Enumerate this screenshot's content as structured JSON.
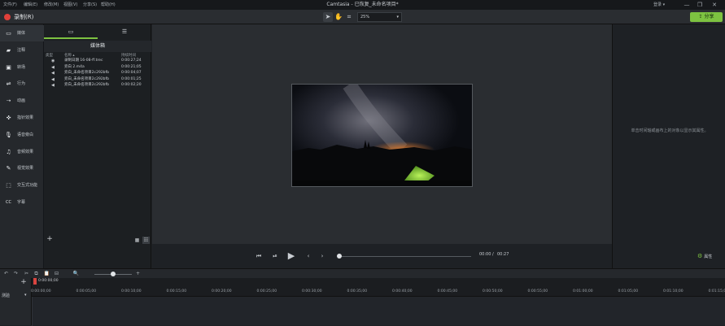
{
  "menu": [
    "文件(F)",
    "编辑(E)",
    "修改(M)",
    "视图(V)",
    "分享(S)",
    "帮助(H)"
  ],
  "app_title": "Camtasia - 已恢复_未命名项目*",
  "account": "登录 ▾",
  "window_controls": [
    "—",
    "❐",
    "✕"
  ],
  "toolbar": {
    "record_label": "录制(R)",
    "zoom_value": "25%",
    "share_label": "分享"
  },
  "sidebar": {
    "items": [
      {
        "label": "媒体",
        "icon": "media-icon",
        "glyph": "▭"
      },
      {
        "label": "注释",
        "icon": "annotation-icon",
        "glyph": "▰"
      },
      {
        "label": "转场",
        "icon": "transition-icon",
        "glyph": "▣"
      },
      {
        "label": "行为",
        "icon": "behavior-icon",
        "glyph": "⇌"
      },
      {
        "label": "动画",
        "icon": "animation-icon",
        "glyph": "➝"
      },
      {
        "label": "指针效果",
        "icon": "cursor-effect-icon",
        "glyph": "✜"
      },
      {
        "label": "语音旁白",
        "icon": "microphone-icon",
        "glyph": "🎙"
      },
      {
        "label": "音频效果",
        "icon": "audio-effect-icon",
        "glyph": "♫"
      },
      {
        "label": "视觉效果",
        "icon": "visual-effect-icon",
        "glyph": "✎"
      },
      {
        "label": "交互式功能",
        "icon": "interactive-icon",
        "glyph": "⬚"
      },
      {
        "label": "字幕",
        "icon": "cc-icon",
        "glyph": "CC"
      }
    ]
  },
  "bin": {
    "title": "媒体箱",
    "columns": {
      "type": "类型",
      "name": "名称 ▴",
      "duration": "持续时间"
    },
    "rows": [
      {
        "icon": "video-file-icon",
        "glyph": "◉",
        "name": "录制日期 16-08-ff.trec",
        "duration": "0:00:27;24"
      },
      {
        "icon": "audio-file-icon",
        "glyph": "◀",
        "name": "旁白 2.m4a",
        "duration": "0:00:21;05"
      },
      {
        "icon": "audio-file-icon",
        "glyph": "◀",
        "name": "旁白_未命名项目2c292bfb",
        "duration": "0:00:04;07"
      },
      {
        "icon": "audio-file-icon",
        "glyph": "◀",
        "name": "旁白_未命名项目2c292bfb",
        "duration": "0:00:01;25"
      },
      {
        "icon": "audio-file-icon",
        "glyph": "◀",
        "name": "旁白_未命名项目2c292bfb",
        "duration": "0:00:02;20"
      }
    ]
  },
  "playback": {
    "current": "00:00",
    "separator": "/",
    "total": "00:27",
    "progress": 0
  },
  "properties": {
    "message": "单击时间轴或画布上的对象以显示其属性。",
    "button": "属性"
  },
  "timeline": {
    "playhead": "0:00:00;00",
    "ticks": [
      "0:00:00;00",
      "0:00:05;00",
      "0:00:10;00",
      "0:00:15;00",
      "0:00:20;00",
      "0:00:25;00",
      "0:00:30;00",
      "0:00:35;00",
      "0:00:40;00",
      "0:00:45;00",
      "0:00:50;00",
      "0:00:55;00",
      "0:01:00;00",
      "0:01:05;00",
      "0:01:10;00",
      "0:01:15;00"
    ],
    "track_label": "测验",
    "zoom_level": 0.45
  },
  "colors": {
    "accent": "#7dc241",
    "record": "#e0403a",
    "playhead": "#d9443f"
  }
}
